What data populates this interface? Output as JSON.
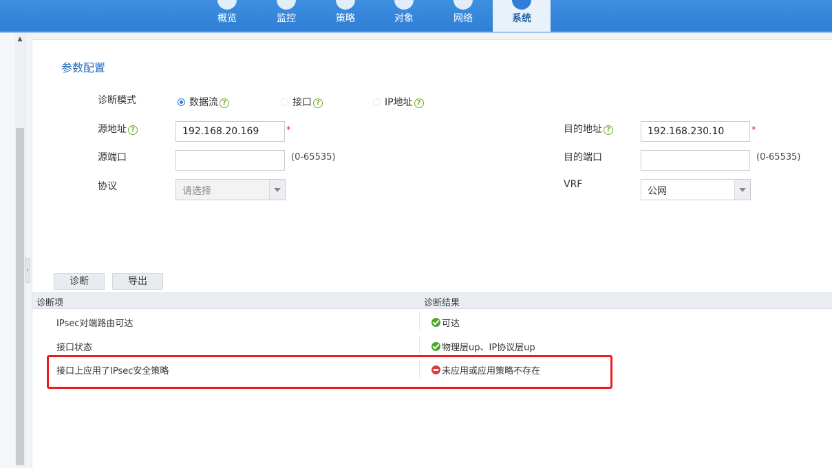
{
  "nav": {
    "items": [
      {
        "label": "概览",
        "active": false
      },
      {
        "label": "监控",
        "active": false
      },
      {
        "label": "策略",
        "active": false
      },
      {
        "label": "对象",
        "active": false
      },
      {
        "label": "网络",
        "active": false
      },
      {
        "label": "系统",
        "active": true
      }
    ]
  },
  "section": {
    "title": "参数配置"
  },
  "form": {
    "mode_label": "诊断模式",
    "modes": [
      {
        "label": "数据流",
        "checked": true
      },
      {
        "label": "接口",
        "checked": false
      },
      {
        "label": "IP地址",
        "checked": false
      }
    ],
    "src_ip_label": "源地址",
    "src_ip_value": "192.168.20.169",
    "dst_ip_label": "目的地址",
    "dst_ip_value": "192.168.230.10",
    "src_port_label": "源端口",
    "src_port_value": "",
    "dst_port_label": "目的端口",
    "dst_port_value": "",
    "port_hint": "(0-65535)",
    "required_mark": "*",
    "help_mark": "?",
    "protocol_label": "协议",
    "protocol_value": "请选择",
    "vrf_label": "VRF",
    "vrf_value": "公网"
  },
  "buttons": {
    "diagnose": "诊断",
    "export": "导出"
  },
  "grid": {
    "col_item": "诊断项",
    "col_result": "诊断结果",
    "rows": [
      {
        "item": "IPsec对端路由可达",
        "result": "可达",
        "status": "ok"
      },
      {
        "item": "接口状态",
        "result": "物理层up、IP协议层up",
        "status": "ok"
      },
      {
        "item": "接口上应用了IPsec安全策略",
        "result": "未应用或应用策略不存在",
        "status": "error"
      }
    ]
  },
  "colors": {
    "accent": "#2f7fd6",
    "ok": "#4aa629",
    "error": "#e03a3a",
    "highlight": "#ee1c1c"
  }
}
